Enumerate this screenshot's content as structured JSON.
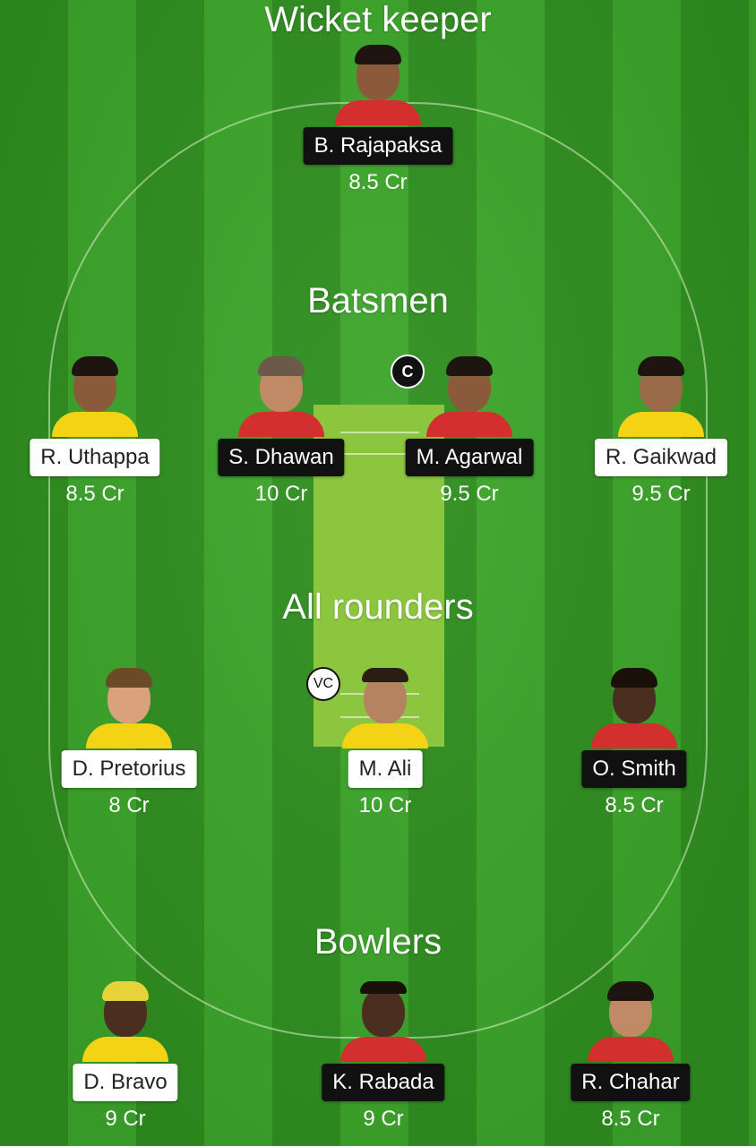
{
  "sections": {
    "wicket_keeper": "Wicket keeper",
    "batsmen": "Batsmen",
    "all_rounders": "All rounders",
    "bowlers": "Bowlers"
  },
  "badges": {
    "captain": "C",
    "vice_captain": "VC"
  },
  "colors": {
    "field_dark": "#2f8f1f",
    "field_light": "#3ca62a",
    "pitch": "#8cc63f",
    "team_yellow": "#f3d313",
    "team_red": "#d32f2f"
  },
  "players": {
    "wk1": {
      "name": "B. Rajapaksa",
      "price": "8.5 Cr",
      "team": "red"
    },
    "bat1": {
      "name": "R. Uthappa",
      "price": "8.5 Cr",
      "team": "yellow"
    },
    "bat2": {
      "name": "S. Dhawan",
      "price": "10 Cr",
      "team": "red"
    },
    "bat3": {
      "name": "M. Agarwal",
      "price": "9.5 Cr",
      "team": "red"
    },
    "bat4": {
      "name": "R. Gaikwad",
      "price": "9.5 Cr",
      "team": "yellow"
    },
    "ar1": {
      "name": "D. Pretorius",
      "price": "8 Cr",
      "team": "yellow"
    },
    "ar2": {
      "name": "M. Ali",
      "price": "10 Cr",
      "team": "yellow"
    },
    "ar3": {
      "name": "O. Smith",
      "price": "8.5 Cr",
      "team": "red"
    },
    "bowl1": {
      "name": "D. Bravo",
      "price": "9 Cr",
      "team": "yellow"
    },
    "bowl2": {
      "name": "K. Rabada",
      "price": "9 Cr",
      "team": "red"
    },
    "bowl3": {
      "name": "R. Chahar",
      "price": "8.5 Cr",
      "team": "red"
    }
  }
}
